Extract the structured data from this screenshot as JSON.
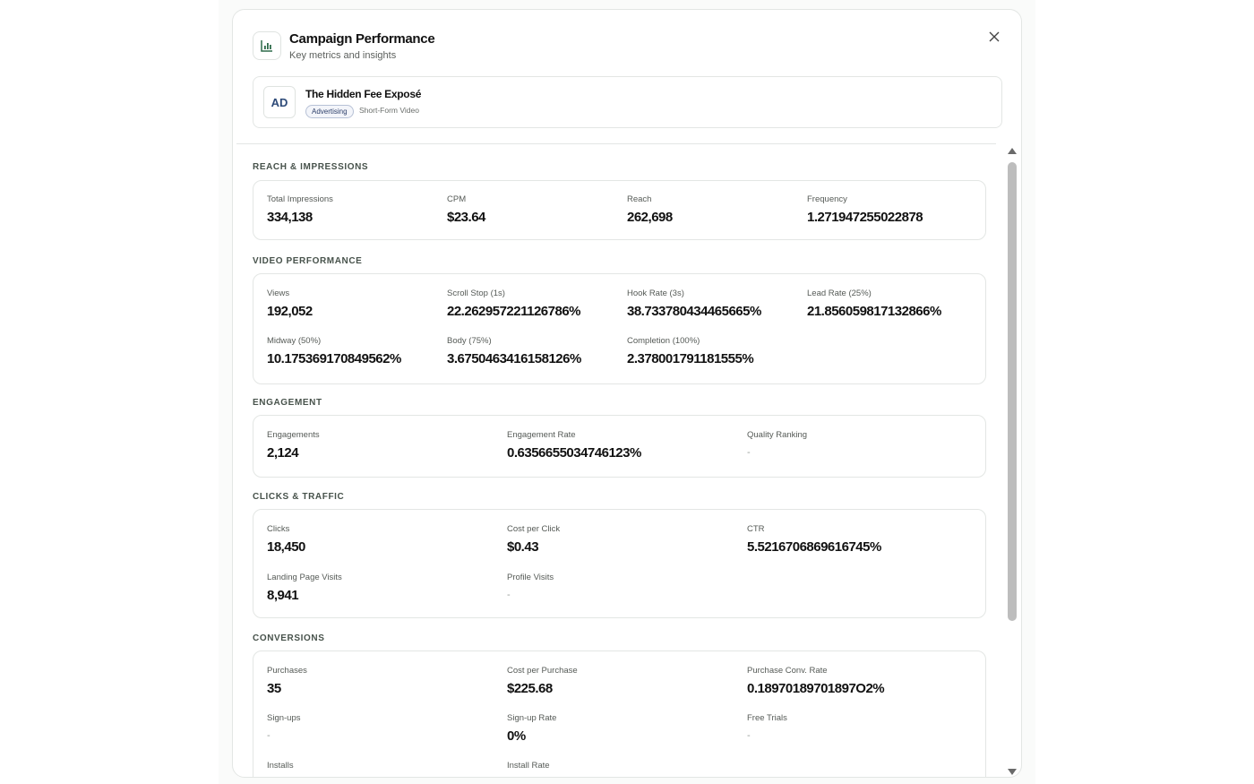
{
  "header": {
    "title": "Campaign Performance",
    "subtitle": "Key metrics and insights"
  },
  "ad": {
    "avatar": "AD",
    "title": "The Hidden Fee Exposé",
    "badge": "Advertising",
    "type": "Short-Form Video"
  },
  "sections": {
    "reach": {
      "title": "REACH & IMPRESSIONS",
      "metrics": [
        {
          "label": "Total Impressions",
          "value": "334,138"
        },
        {
          "label": "CPM",
          "value": "$23.64"
        },
        {
          "label": "Reach",
          "value": "262,698"
        },
        {
          "label": "Frequency",
          "value": "1.271947255022878"
        }
      ]
    },
    "video": {
      "title": "VIDEO PERFORMANCE",
      "metrics": [
        {
          "label": "Views",
          "value": "192,052"
        },
        {
          "label": "Scroll Stop (1s)",
          "value": "22.262957221126786%"
        },
        {
          "label": "Hook Rate (3s)",
          "value": "38.733780434465665%"
        },
        {
          "label": "Lead Rate (25%)",
          "value": "21.856059817132866%"
        },
        {
          "label": "Midway (50%)",
          "value": "10.175369170849562%"
        },
        {
          "label": "Body (75%)",
          "value": "3.6750463416158126%"
        },
        {
          "label": "Completion (100%)",
          "value": "2.378001791181555%"
        }
      ]
    },
    "engagement": {
      "title": "ENGAGEMENT",
      "metrics": [
        {
          "label": "Engagements",
          "value": "2,124"
        },
        {
          "label": "Engagement Rate",
          "value": "0.6356655034746123%"
        },
        {
          "label": "Quality Ranking",
          "value": "-"
        }
      ]
    },
    "clicks": {
      "title": "CLICKS & TRAFFIC",
      "metrics": [
        {
          "label": "Clicks",
          "value": "18,450"
        },
        {
          "label": "Cost per Click",
          "value": "$0.43"
        },
        {
          "label": "CTR",
          "value": "5.5216706869616745%"
        },
        {
          "label": "Landing Page Visits",
          "value": "8,941"
        },
        {
          "label": "Profile Visits",
          "value": "-"
        }
      ]
    },
    "conversions": {
      "title": "CONVERSIONS",
      "metrics": [
        {
          "label": "Purchases",
          "value": "35"
        },
        {
          "label": "Cost per Purchase",
          "value": "$225.68"
        },
        {
          "label": "Purchase Conv. Rate",
          "value": "0.18970189701897O2%"
        },
        {
          "label": "Sign-ups",
          "value": "-"
        },
        {
          "label": "Sign-up Rate",
          "value": "0%"
        },
        {
          "label": "Free Trials",
          "value": "-"
        },
        {
          "label": "Installs",
          "value": ""
        },
        {
          "label": "Install Rate",
          "value": ""
        }
      ]
    }
  },
  "icons": {
    "header": "bar-chart-icon",
    "close": "close-icon"
  },
  "colors": {
    "accent": "#2e6b4a",
    "badge_border": "#b7c1d6"
  }
}
